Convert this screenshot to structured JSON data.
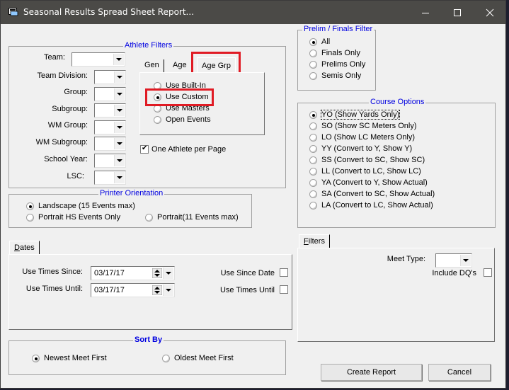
{
  "window": {
    "title": "Seasonal Results Spread Sheet Report...",
    "icon": "app-icon",
    "controls": {
      "minimize": "minimize-icon",
      "maximize": "maximize-icon",
      "close": "close-icon"
    }
  },
  "athlete_filters": {
    "legend": "Athlete Filters",
    "fields": [
      {
        "label": "Team:",
        "value": ""
      },
      {
        "label": "Team Division:",
        "value": ""
      },
      {
        "label": "Group:",
        "value": ""
      },
      {
        "label": "Subgroup:",
        "value": ""
      },
      {
        "label": "WM Group:",
        "value": ""
      },
      {
        "label": "WM Subgroup:",
        "value": ""
      },
      {
        "label": "School Year:",
        "value": ""
      },
      {
        "label": "LSC:",
        "value": ""
      }
    ],
    "tabs": [
      {
        "label": "Gen",
        "active": false
      },
      {
        "label": "Age",
        "active": false
      },
      {
        "label": "Age Grp",
        "active": true,
        "highlighted": true
      }
    ],
    "age_group_options": [
      {
        "label": "Use Built-In",
        "selected": false
      },
      {
        "label": "Use Custom",
        "selected": true,
        "highlighted": true
      },
      {
        "label": "Use Masters",
        "selected": false
      },
      {
        "label": "Open Events",
        "selected": false
      }
    ],
    "one_athlete_per_page": {
      "label": "One Athlete per Page",
      "checked": true
    }
  },
  "prelim_finals": {
    "legend": "Prelim / Finals Filter",
    "options": [
      {
        "label": "All",
        "selected": true
      },
      {
        "label": "Finals Only",
        "selected": false
      },
      {
        "label": "Prelims Only",
        "selected": false
      },
      {
        "label": "Semis Only",
        "selected": false
      }
    ]
  },
  "course_options": {
    "legend": "Course Options",
    "options": [
      {
        "label": "YO (Show Yards Only)",
        "selected": true
      },
      {
        "label": "SO (Show SC Meters Only)",
        "selected": false
      },
      {
        "label": "LO (Show LC Meters Only)",
        "selected": false
      },
      {
        "label": "YY (Convert to Y, Show Y)",
        "selected": false
      },
      {
        "label": "SS (Convert to SC, Show SC)",
        "selected": false
      },
      {
        "label": "LL (Convert to LC, Show LC)",
        "selected": false
      },
      {
        "label": "YA (Convert to Y, Show Actual)",
        "selected": false
      },
      {
        "label": "SA (Convert to SC, Show Actual)",
        "selected": false
      },
      {
        "label": "LA (Convert to LC, Show Actual)",
        "selected": false
      }
    ]
  },
  "printer_orientation": {
    "legend": "Printer Orientation",
    "options": [
      {
        "label": "Landscape (15 Events max)",
        "selected": true
      },
      {
        "label": "Portrait HS Events Only",
        "selected": false
      },
      {
        "label": "Portrait(11 Events max)",
        "selected": false
      }
    ]
  },
  "dates": {
    "tab_label_underline": "D",
    "tab_label_rest": "ates",
    "since": {
      "label": "Use Times Since:",
      "value": "03/17/17"
    },
    "until": {
      "label": "Use Times Until:",
      "value": "03/17/17"
    },
    "use_since_date": {
      "label": "Use Since Date",
      "checked": false
    },
    "use_times_until": {
      "label": "Use Times Until",
      "checked": false
    }
  },
  "filters": {
    "tab_label_underline": "F",
    "tab_label_rest": "ilters",
    "meet_type": {
      "label": "Meet Type:",
      "value": ""
    },
    "include_dqs": {
      "label": "Include DQ's",
      "checked": false
    }
  },
  "sort_by": {
    "legend": "Sort By",
    "options": [
      {
        "label": "Newest Meet First",
        "selected": true
      },
      {
        "label": "Oldest Meet First",
        "selected": false
      }
    ]
  },
  "buttons": {
    "create_report": "Create Report",
    "cancel": "Cancel"
  },
  "colors": {
    "legend_blue": "#0000e0",
    "highlight_red": "#e01b24",
    "titlebar": "#4b4a47"
  }
}
